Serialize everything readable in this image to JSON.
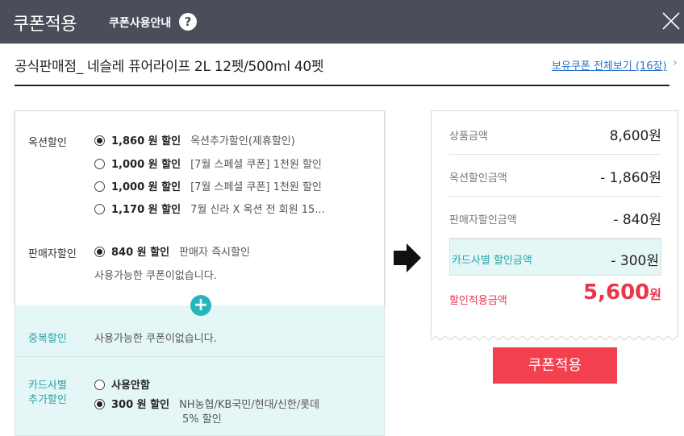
{
  "header": {
    "title": "쿠폰적용",
    "guide": "쿠폰사용안내",
    "help_icon": "?",
    "bg_color": "#4a4d5a"
  },
  "product": {
    "name": "공식판매점_ 네슬레 퓨어라이프 2L 12펫/500ml 40펫",
    "all_coupons": "보유쿠폰 전체보기 (16장)",
    "chevron": "›"
  },
  "auction_discount": {
    "label": "옥션할인",
    "options": [
      {
        "amount": "1,860 원 할인",
        "desc": "옥션추가할인(제휴할인)",
        "selected": true
      },
      {
        "amount": "1,000 원 할인",
        "desc": "[7월 스페셜 쿠폰] 1천원 할인",
        "selected": false
      },
      {
        "amount": "1,000 원 할인",
        "desc": "[7월 스페셜 쿠폰] 1천원 할인",
        "selected": false
      },
      {
        "amount": "1,170 원 할인",
        "desc": "7월 신라 X 옥션 전 회원 15...",
        "selected": false
      }
    ]
  },
  "seller_discount": {
    "label": "판매자할인",
    "option": {
      "amount": "840 원 할인",
      "desc": "판매자 즉시할인",
      "selected": true
    },
    "note": "사용가능한 쿠폰이없습니다."
  },
  "duplicate_discount": {
    "label": "중복할인",
    "note": "사용가능한 쿠폰이없습니다."
  },
  "card_discount": {
    "label_line1": "카드사별",
    "label_line2": "추가할인",
    "opt_none": "사용안함",
    "opt_amount": "300 원 할인",
    "opt_desc_line1": "NH농협/KB국민/현대/신한/롯데",
    "opt_desc_line2": "5% 할인"
  },
  "summary": {
    "product_price_label": "상품금액",
    "product_price": "8,600원",
    "auction_discount_label": "옥션할인금액",
    "auction_discount": "- 1,860원",
    "seller_discount_label": "판매자할인금액",
    "seller_discount": "- 840원",
    "card_discount_label": "카드사별 할인금액",
    "card_discount": "- 300원",
    "final_label": "할인적용금액",
    "final_amount": "5,600",
    "final_unit": "원"
  },
  "apply_button": "쿠폰적용",
  "colors": {
    "accent_red": "#f3404f",
    "teal": "#25b6bd",
    "teal_bg": "#e5f6f6",
    "link_blue": "#2a6fc9"
  }
}
